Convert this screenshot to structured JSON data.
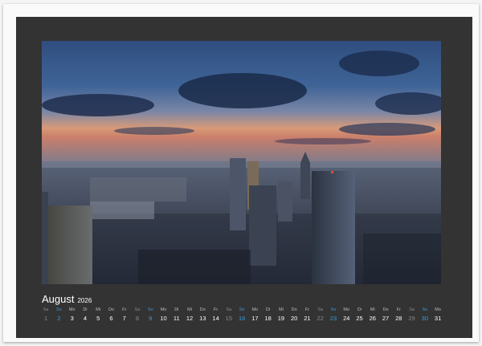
{
  "calendar": {
    "month": "August",
    "year": "2026",
    "weekday_labels": [
      "Sa",
      "So",
      "Mo",
      "Di",
      "Mi",
      "Do",
      "Fr",
      "Sa",
      "So",
      "Mo",
      "Di",
      "Mi",
      "Do",
      "Fr",
      "Sa",
      "So",
      "Mo",
      "Di",
      "Mi",
      "Do",
      "Fr",
      "Sa",
      "So",
      "Mo",
      "Di",
      "Mi",
      "Do",
      "Fr",
      "Sa",
      "So",
      "Mo"
    ],
    "days": [
      "1",
      "2",
      "3",
      "4",
      "5",
      "6",
      "7",
      "8",
      "9",
      "10",
      "11",
      "12",
      "13",
      "14",
      "15",
      "16",
      "17",
      "18",
      "19",
      "20",
      "21",
      "22",
      "23",
      "24",
      "25",
      "26",
      "27",
      "28",
      "29",
      "30",
      "31"
    ]
  },
  "colors": {
    "panel": "#333333",
    "sunday": "#3a9ad9",
    "saturday": "#8a8a8a",
    "weekday": "#ffffff"
  },
  "photo": {
    "subject": "city skyline at dusk"
  }
}
